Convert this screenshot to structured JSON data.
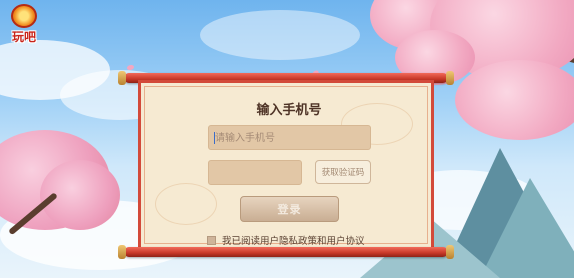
{
  "brand": {
    "logo_text": "玩吧"
  },
  "login": {
    "title": "输入手机号",
    "phone_placeholder": "请输入手机号",
    "phone_value": "",
    "code_value": "",
    "get_code_label": "获取验证码",
    "login_label": "登录",
    "agreement_text": "我已阅读用户隐私政策和用户协议",
    "agreement_checked": false
  },
  "colors": {
    "panel_bg": "#f6ead2",
    "frame_red": "#d34a3a",
    "field_bg": "#e2c7a6"
  }
}
